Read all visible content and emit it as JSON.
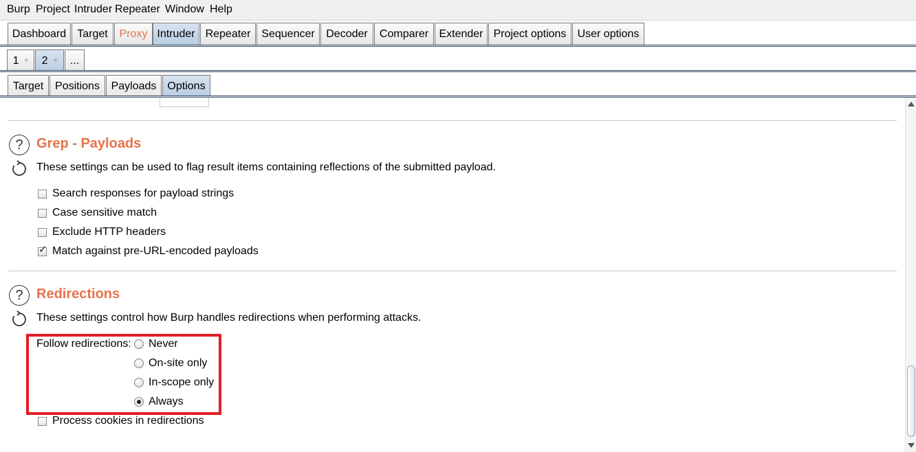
{
  "menu": [
    "Burp",
    "Project",
    "Intruder",
    "Repeater",
    "Window",
    "Help"
  ],
  "main_tabs": [
    "Dashboard",
    "Target",
    "Proxy",
    "Intruder",
    "Repeater",
    "Sequencer",
    "Decoder",
    "Comparer",
    "Extender",
    "Project options",
    "User options"
  ],
  "main_tab_selected": "Intruder",
  "attack_tabs": [
    {
      "label": "1",
      "close": "×"
    },
    {
      "label": "2",
      "close": "×"
    },
    {
      "label": "..."
    }
  ],
  "attack_tab_selected": "2",
  "sub_tabs": [
    "Target",
    "Positions",
    "Payloads",
    "Options"
  ],
  "sub_tab_selected": "Options",
  "grep_payloads": {
    "title": "Grep - Payloads",
    "description": "These settings can be used to flag result items containing reflections of the submitted payload.",
    "options": [
      {
        "label": "Search responses for payload strings",
        "checked": false
      },
      {
        "label": "Case sensitive match",
        "checked": false
      },
      {
        "label": "Exclude HTTP headers",
        "checked": false
      },
      {
        "label": "Match against pre-URL-encoded payloads",
        "checked": true
      }
    ]
  },
  "redirections": {
    "title": "Redirections",
    "description": "These settings control how Burp handles redirections when performing attacks.",
    "follow_label": "Follow redirections:",
    "options": [
      {
        "label": "Never",
        "selected": false
      },
      {
        "label": "On-site only",
        "selected": false
      },
      {
        "label": "In-scope only",
        "selected": false
      },
      {
        "label": "Always",
        "selected": true
      }
    ],
    "process_cookies": {
      "label": "Process cookies in redirections",
      "checked": false
    }
  },
  "icons": {
    "help": "help-icon",
    "refresh": "refresh-icon"
  },
  "colors": {
    "section_title": "#e8724a",
    "highlight_box": "#e31e24",
    "selected_tab": "#c4d5e8"
  }
}
